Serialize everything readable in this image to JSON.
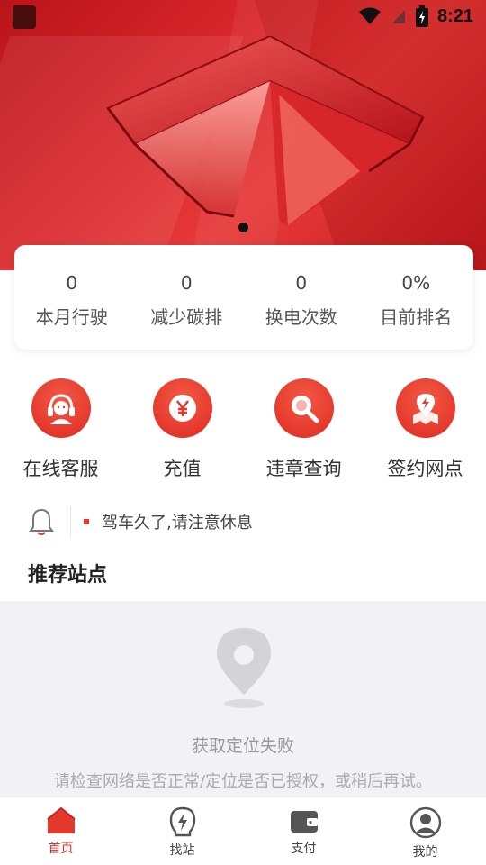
{
  "status_bar": {
    "time": "8:21"
  },
  "stats": [
    {
      "value": "0",
      "label": "本月行驶"
    },
    {
      "value": "0",
      "label": "减少碳排"
    },
    {
      "value": "0",
      "label": "换电次数"
    },
    {
      "value": "0%",
      "label": "目前排名"
    }
  ],
  "actions": [
    {
      "label": "在线客服",
      "icon": "headset-icon"
    },
    {
      "label": "充值",
      "icon": "yen-icon"
    },
    {
      "label": "违章查询",
      "icon": "search-icon"
    },
    {
      "label": "签约网点",
      "icon": "map-pin-icon"
    }
  ],
  "notice": {
    "text": "驾车久了,请注意休息"
  },
  "section": {
    "title": "推荐站点"
  },
  "empty_state": {
    "message": "获取定位失败",
    "hint": "请检查网络是否正常/定位是否已授权，或稍后再试。"
  },
  "tabs": [
    {
      "label": "首页",
      "icon": "home-icon",
      "active": true
    },
    {
      "label": "找站",
      "icon": "lightning-icon",
      "active": false
    },
    {
      "label": "支付",
      "icon": "wallet-icon",
      "active": false
    },
    {
      "label": "我的",
      "icon": "user-icon",
      "active": false
    }
  ],
  "colors": {
    "accent": "#e5382c",
    "active_tab": "#d9322a"
  }
}
